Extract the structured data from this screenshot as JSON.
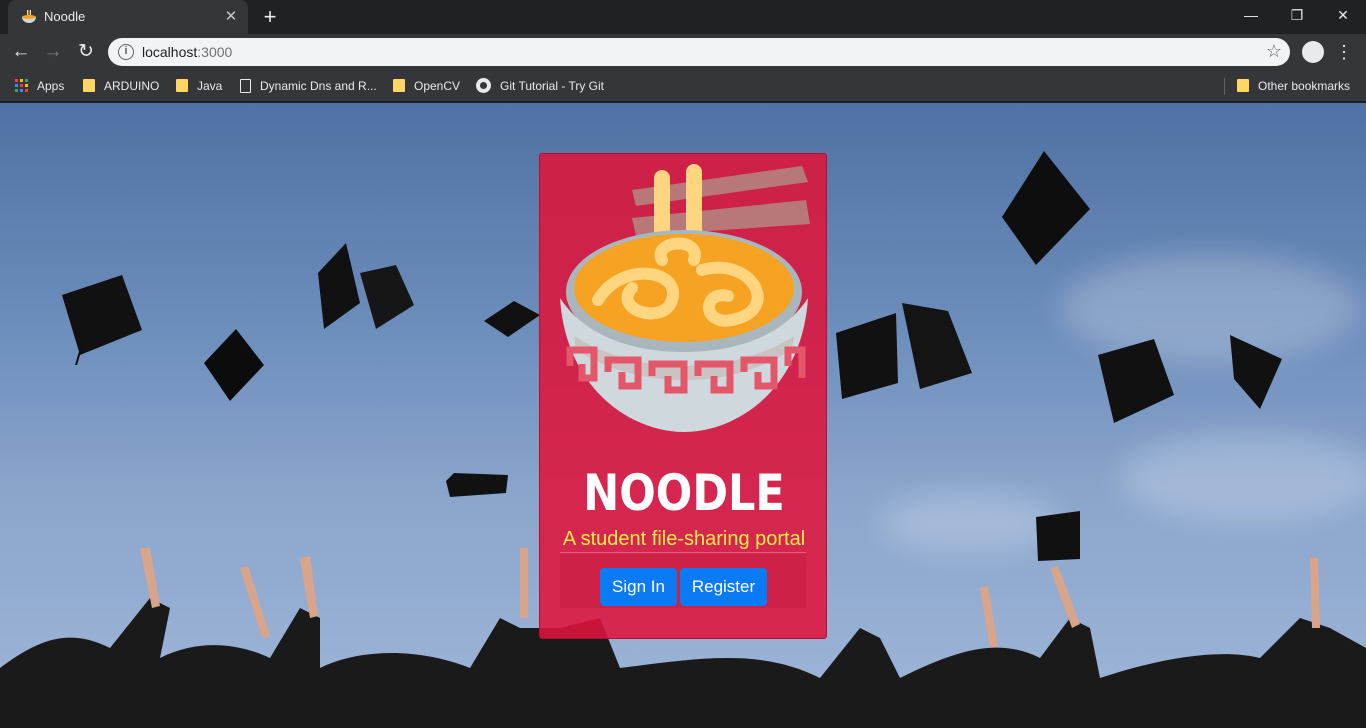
{
  "browser": {
    "tab_title": "Noodle",
    "tab_close": "✕",
    "new_tab": "+",
    "url_host": "localhost",
    "url_port": ":3000",
    "info_glyph": "i",
    "star_glyph": "☆",
    "menu_glyph": "⋮",
    "back_glyph": "←",
    "forward_glyph": "→",
    "reload_glyph": "↻",
    "minimize_glyph": "—",
    "restore_glyph": "❐",
    "close_glyph": "✕",
    "bookmarks": [
      {
        "label": "Apps",
        "icon": "apps-icon"
      },
      {
        "label": "ARDUINO",
        "icon": "folder-icon"
      },
      {
        "label": "Java",
        "icon": "folder-icon"
      },
      {
        "label": "Dynamic Dns and R...",
        "icon": "page-icon"
      },
      {
        "label": "OpenCV",
        "icon": "folder-icon"
      },
      {
        "label": "Git Tutorial - Try Git",
        "icon": "github-icon"
      }
    ],
    "other_bookmarks": "Other bookmarks"
  },
  "page": {
    "brand": "NOODLE",
    "tagline": "A student file-sharing portal",
    "signin_label": "Sign In",
    "register_label": "Register"
  },
  "colors": {
    "card": "#de143c",
    "button": "#0a7bf5",
    "tagline": "#ffe94a"
  }
}
